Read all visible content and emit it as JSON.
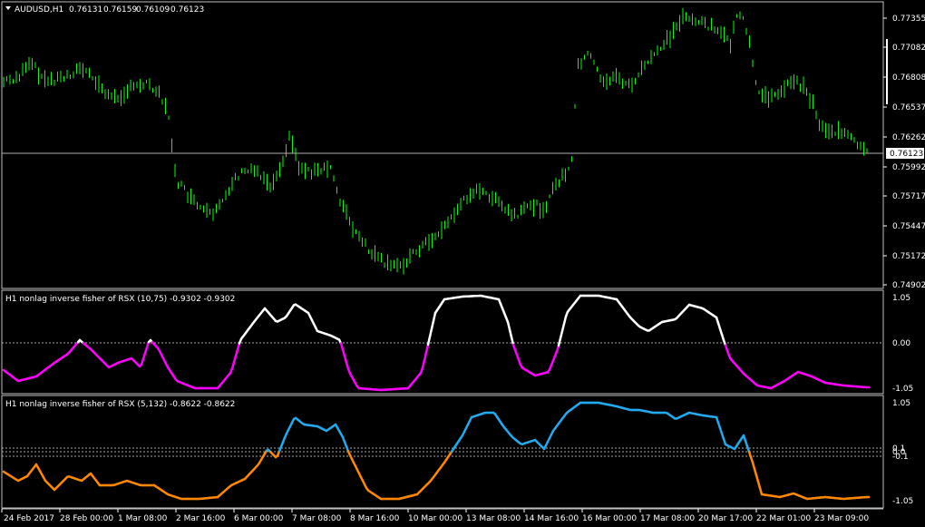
{
  "main": {
    "symbol_label": "AUDUSD,H1",
    "ohlc": [
      "0.76131",
      "0.76159",
      "0.76109",
      "0.76123"
    ],
    "price_labels": [
      "0.77355",
      "0.77082",
      "0.76808",
      "0.76537",
      "0.76262",
      "0.75992",
      "0.75717",
      "0.75447",
      "0.75172",
      "0.74902"
    ],
    "current_price": "0.76123",
    "candle_color": "#00ff00"
  },
  "indicator1": {
    "title": "H1 nonlag inverse fisher of RSX (10,75) -0.9302 -0.9302",
    "levels": [
      "1.05",
      "0.00",
      "-1.05"
    ],
    "up_color": "#ffffff",
    "down_color": "#ff00ff"
  },
  "indicator2": {
    "title": "H1 nonlag inverse fisher of RSX (5,132) -0.8622 -0.8622",
    "levels": [
      "1.05",
      "0.1",
      "0.0",
      "-0.1",
      "-1.05"
    ],
    "up_color": "#22aaee",
    "down_color": "#ff8800"
  },
  "time_labels": [
    "24 Feb 2017",
    "28 Feb 00:00",
    "1 Mar 08:00",
    "2 Mar 16:00",
    "6 Mar 00:00",
    "7 Mar 08:00",
    "8 Mar 16:00",
    "10 Mar 00:00",
    "13 Mar 08:00",
    "14 Mar 16:00",
    "16 Mar 00:00",
    "17 Mar 08:00",
    "20 Mar 17:00",
    "22 Mar 01:00",
    "23 Mar 09:00"
  ]
}
